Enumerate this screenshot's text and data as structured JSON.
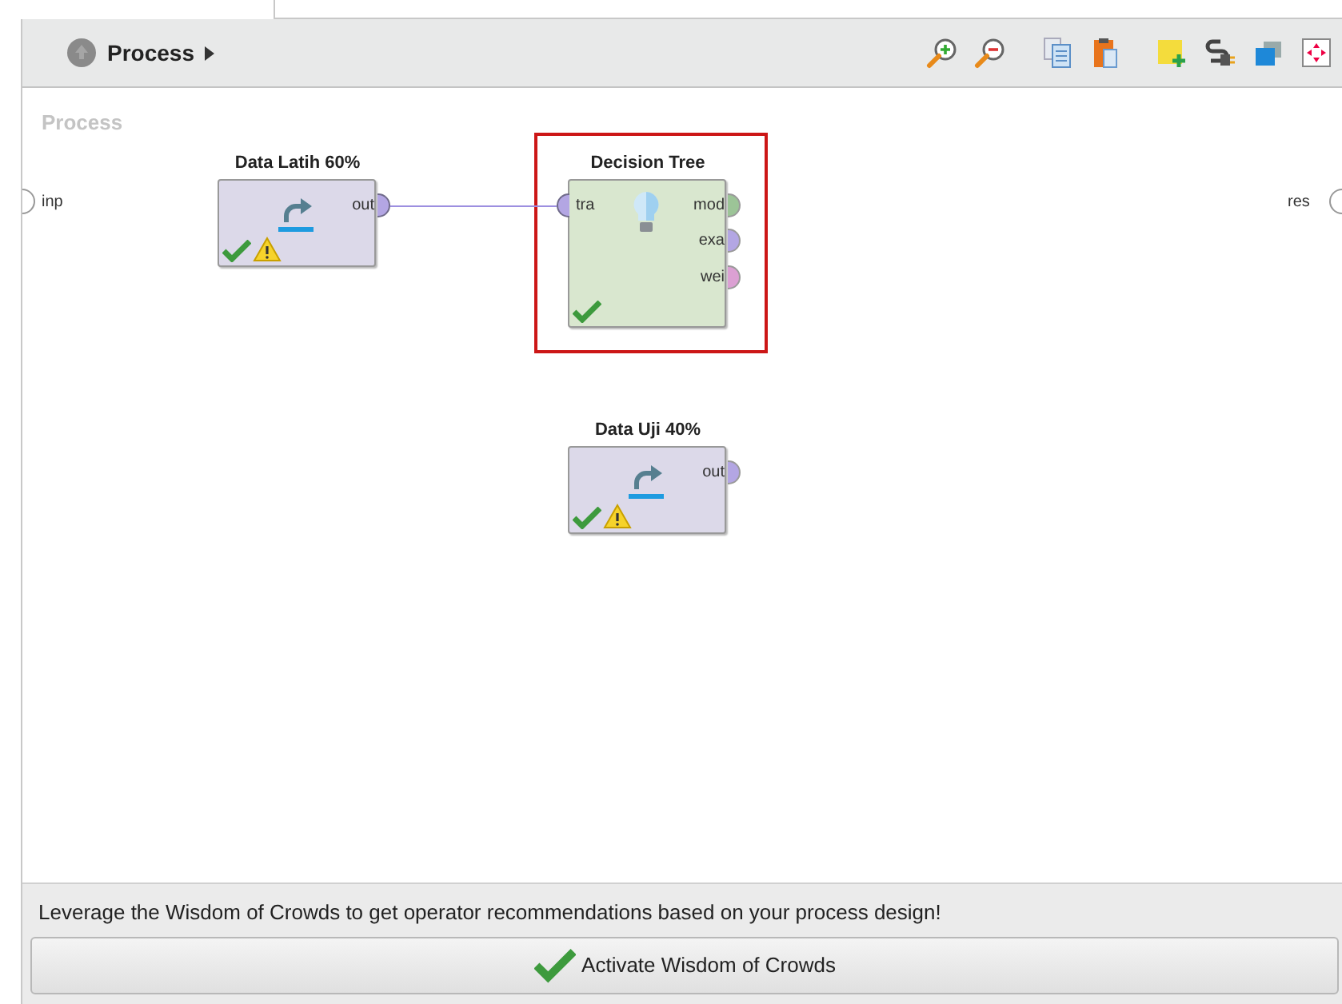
{
  "breadcrumb": {
    "label": "Process"
  },
  "canvas": {
    "title": "Process",
    "input_port": "inp",
    "result_port": "res"
  },
  "operators": [
    {
      "title": "Data Latih 60%",
      "kind": "retrieve",
      "highlighted": false,
      "ok": true,
      "warning": true,
      "outputs": [
        {
          "label": "out",
          "color": "#b3a6e3",
          "connected": true
        }
      ]
    },
    {
      "title": "Decision Tree",
      "kind": "learner",
      "highlighted": true,
      "ok": true,
      "warning": false,
      "inputs": [
        {
          "label": "tra",
          "color": "#b3a6e3",
          "connected": true
        }
      ],
      "outputs": [
        {
          "label": "mod",
          "color": "#9cc497",
          "connected": false
        },
        {
          "label": "exa",
          "color": "#b3a6e3",
          "connected": false
        },
        {
          "label": "wei",
          "color": "#dba0d3",
          "connected": false
        }
      ]
    },
    {
      "title": "Data Uji 40%",
      "kind": "retrieve",
      "highlighted": false,
      "ok": true,
      "warning": true,
      "outputs": [
        {
          "label": "out",
          "color": "#b3a6e3",
          "connected": false
        }
      ]
    }
  ],
  "footer": {
    "message": "Leverage the Wisdom of Crowds to get operator recommendations based on your process design!",
    "button": "Activate Wisdom of Crowds"
  }
}
